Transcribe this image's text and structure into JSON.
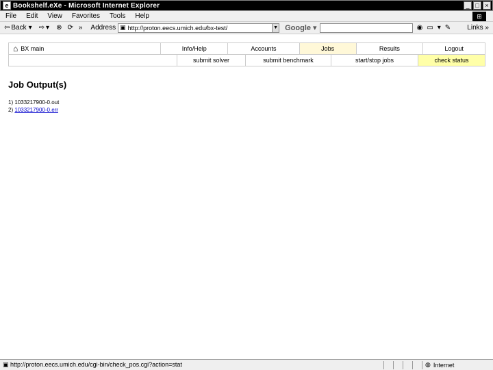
{
  "window": {
    "title": "Bookshelf.eXe - Microsoft Internet Explorer"
  },
  "menu": [
    "File",
    "Edit",
    "View",
    "Favorites",
    "Tools",
    "Help"
  ],
  "toolbar": {
    "back": "Back",
    "address_label": "Address",
    "url": "http://proton.eecs.umich.edu/bx-test/",
    "google_label": "Google",
    "links_label": "Links"
  },
  "nav": {
    "home": "BX main",
    "items": [
      "Info/Help",
      "Accounts",
      "Jobs",
      "Results",
      "Logout"
    ],
    "sub_items": [
      "submit solver",
      "submit benchmark",
      "start/stop jobs",
      "check status"
    ]
  },
  "page": {
    "heading": "Job Output(s)",
    "outputs": [
      {
        "index": "1)",
        "file": "1033217900-0.out",
        "link": false
      },
      {
        "index": "2)",
        "file": "1033217900-0.err",
        "link": true
      }
    ]
  },
  "status": {
    "text": "http://proton.eecs.umich.edu/cgi-bin/check_pos.cgi?action=stat",
    "zone": "Internet"
  }
}
